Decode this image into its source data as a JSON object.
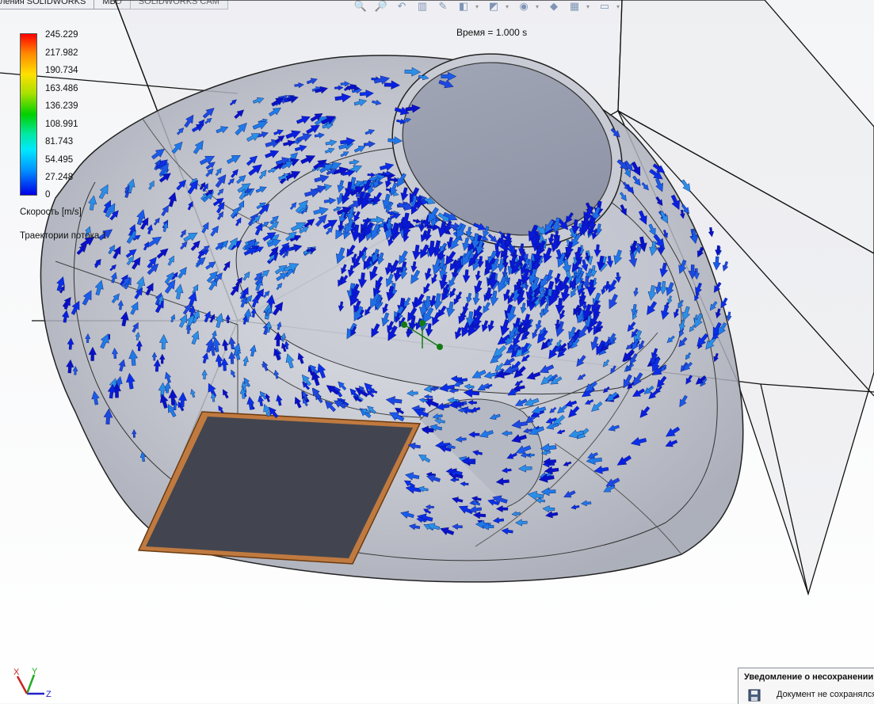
{
  "tabs": [
    "ления SOLIDWORKS",
    "MBD",
    "SOLIDWORKS CAM"
  ],
  "toolbar": {
    "icons": [
      "zoom-to-fit-icon",
      "zoom-area-icon",
      "previous-view-icon",
      "section-view-icon",
      "dynamic-annotation-icon",
      "view-orientation-icon",
      "display-style-icon",
      "hide-show-icon",
      "edit-appearance-icon",
      "apply-scene-icon",
      "view-settings-icon"
    ]
  },
  "viewport": {
    "time_label": "Время = 1.000 s"
  },
  "legend": {
    "values": [
      "245.229",
      "217.982",
      "190.734",
      "163.486",
      "136.239",
      "108.991",
      "81.743",
      "54.495",
      "27.248",
      "0"
    ],
    "unit_label": "Скорость [m/s]",
    "trajectories_label": "Траектории потока 1",
    "colors": [
      "#ff0000",
      "#ff8800",
      "#ffe000",
      "#a8e000",
      "#00d000",
      "#00e8a0",
      "#00e8ff",
      "#0090ff",
      "#0000e8"
    ]
  },
  "triad": {
    "x": "X",
    "y": "Y",
    "z": "Z"
  },
  "notification": {
    "title": "Уведомление о несохранении",
    "message": "Документ не сохранялся"
  }
}
